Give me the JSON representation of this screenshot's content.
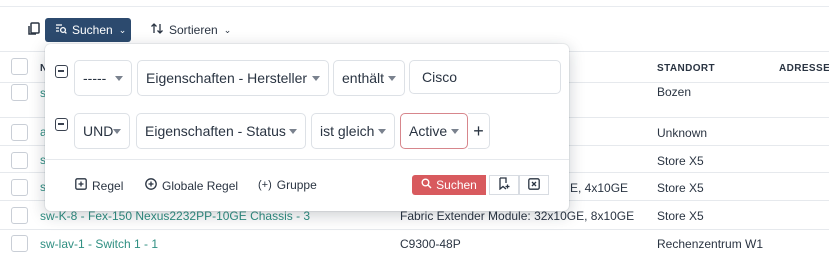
{
  "toolbar": {
    "search_label": "Suchen",
    "sort_label": "Sortieren"
  },
  "table": {
    "columns": [
      "N",
      "STANDORT",
      "ADRESSE"
    ],
    "rows": [
      {
        "name": "s",
        "model": "",
        "location": "Bozen"
      },
      {
        "name": "a",
        "model": "",
        "location": "Unknown"
      },
      {
        "name": "s",
        "model": "",
        "location": "Store X5"
      },
      {
        "name": "s",
        "model": "E, 4x10GE",
        "location": "Store X5"
      },
      {
        "name": "sw-K-8 - Fex-150 Nexus2232PP-10GE Chassis - 3",
        "model": "Fabric Extender Module: 32x10GE, 8x10GE",
        "location": "Store X5"
      },
      {
        "name": "sw-lav-1 - Switch 1 - 1",
        "model": "C9300-48P",
        "location": "Rechenzentrum W1"
      }
    ]
  },
  "search_panel": {
    "rules": [
      {
        "conjunction": "-----",
        "field": "Eigenschaften - Hersteller",
        "operator": "enthält",
        "value": "Cisco"
      },
      {
        "conjunction": "UND",
        "field": "Eigenschaften - Status",
        "operator": "ist gleich",
        "value": "Active"
      }
    ],
    "add_rule_label": "Regel",
    "add_global_rule_label": "Globale Regel",
    "add_group_label": "Gruppe",
    "group_symbol": "(+)",
    "submit_label": "Suchen",
    "plus_symbol": "+"
  },
  "colors": {
    "primary": "#2c4a6e",
    "link": "#2f8f82",
    "danger": "#d85a5e"
  }
}
